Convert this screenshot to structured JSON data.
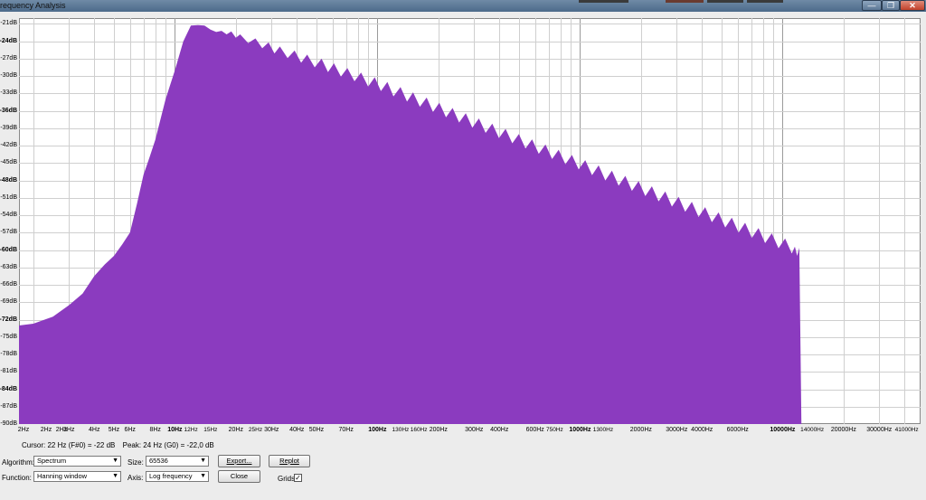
{
  "window": {
    "title": "requency Analysis",
    "controls": {
      "minimize_icon": "—",
      "maximize_icon": "❐",
      "close_icon": "✕"
    }
  },
  "colors": {
    "spectrum_fill": "#8b3bbf",
    "grid": "#cfcfcf",
    "plot_bg": "#ffffff",
    "close_red": "#c1412a"
  },
  "status": {
    "cursor": "Cursor: 22 Hz (F#0) = -22 dB",
    "peak": "Peak: 24 Hz (G0) = -22,0 dB"
  },
  "controls": {
    "algorithm_label": "Algorithm:",
    "algorithm_value": "Spectrum",
    "size_label": "Size:",
    "size_value": "65536",
    "export_label": "Export...",
    "replot_label": "Replot",
    "function_label": "Function:",
    "function_value": "Hanning window",
    "axis_label": "Axis:",
    "axis_value": "Log frequency",
    "close_label": "Close",
    "grids_label": "Grids",
    "grids_checked": true,
    "grids_check": "✓"
  },
  "chart_data": {
    "type": "area",
    "x_scale": "log",
    "xlim": [
      1.7,
      48000
    ],
    "ylim": [
      -90,
      -20
    ],
    "grid": true,
    "y_ticks": [
      {
        "v": -21,
        "label": "-21dB",
        "bold": false
      },
      {
        "v": -24,
        "label": "-24dB",
        "bold": true
      },
      {
        "v": -27,
        "label": "-27dB",
        "bold": false
      },
      {
        "v": -30,
        "label": "-30dB",
        "bold": false
      },
      {
        "v": -33,
        "label": "-33dB",
        "bold": false
      },
      {
        "v": -36,
        "label": "-36dB",
        "bold": true
      },
      {
        "v": -39,
        "label": "-39dB",
        "bold": false
      },
      {
        "v": -42,
        "label": "-42dB",
        "bold": false
      },
      {
        "v": -45,
        "label": "-45dB",
        "bold": false
      },
      {
        "v": -48,
        "label": "-48dB",
        "bold": true
      },
      {
        "v": -51,
        "label": "-51dB",
        "bold": false
      },
      {
        "v": -54,
        "label": "-54dB",
        "bold": false
      },
      {
        "v": -57,
        "label": "-57dB",
        "bold": false
      },
      {
        "v": -60,
        "label": "-60dB",
        "bold": true
      },
      {
        "v": -63,
        "label": "-63dB",
        "bold": false
      },
      {
        "v": -66,
        "label": "-66dB",
        "bold": false
      },
      {
        "v": -69,
        "label": "-69dB",
        "bold": false
      },
      {
        "v": -72,
        "label": "-72dB",
        "bold": true
      },
      {
        "v": -75,
        "label": "-75dB",
        "bold": false
      },
      {
        "v": -78,
        "label": "-78dB",
        "bold": false
      },
      {
        "v": -81,
        "label": "-81dB",
        "bold": false
      },
      {
        "v": -84,
        "label": "-84dB",
        "bold": true
      },
      {
        "v": -87,
        "label": "-87dB",
        "bold": false
      },
      {
        "v": -90,
        "label": "-90dB",
        "bold": false
      }
    ],
    "x_ticks": [
      {
        "v": 2,
        "label": "2Hz"
      },
      {
        "v": 2,
        "label": "2Hz"
      },
      {
        "v": 2,
        "label": "2Hz"
      },
      {
        "v": 3,
        "label": "3Hz"
      },
      {
        "v": 4,
        "label": "4Hz"
      },
      {
        "v": 5,
        "label": "5Hz"
      },
      {
        "v": 6,
        "label": "6Hz"
      },
      {
        "v": 8,
        "label": "8Hz"
      },
      {
        "v": 10,
        "label": "10Hz",
        "bold": true
      },
      {
        "v": 12,
        "label": "12Hz",
        "small": true
      },
      {
        "v": 15,
        "label": "15Hz",
        "small": true
      },
      {
        "v": 20,
        "label": "20Hz"
      },
      {
        "v": 25,
        "label": "25Hz",
        "small": true
      },
      {
        "v": 30,
        "label": "30Hz"
      },
      {
        "v": 40,
        "label": "40Hz"
      },
      {
        "v": 50,
        "label": "50Hz"
      },
      {
        "v": 70,
        "label": "70Hz"
      },
      {
        "v": 100,
        "label": "100Hz",
        "bold": true
      },
      {
        "v": 130,
        "label": "130Hz",
        "small": true
      },
      {
        "v": 160,
        "label": "160Hz",
        "small": true
      },
      {
        "v": 200,
        "label": "200Hz"
      },
      {
        "v": 300,
        "label": "300Hz"
      },
      {
        "v": 400,
        "label": "400Hz"
      },
      {
        "v": 600,
        "label": "600Hz"
      },
      {
        "v": 750,
        "label": "750Hz",
        "small": true
      },
      {
        "v": 1000,
        "label": "1000Hz",
        "bold": true
      },
      {
        "v": 1300,
        "label": "1300Hz",
        "small": true
      },
      {
        "v": 2000,
        "label": "2000Hz"
      },
      {
        "v": 3000,
        "label": "3000Hz"
      },
      {
        "v": 4000,
        "label": "4000Hz"
      },
      {
        "v": 6000,
        "label": "6000Hz"
      },
      {
        "v": 10000,
        "label": "10000Hz",
        "bold": true
      },
      {
        "v": 14000,
        "label": "14000Hz",
        "small": true
      },
      {
        "v": 20000,
        "label": "20000Hz"
      },
      {
        "v": 30000,
        "label": "30000Hz"
      },
      {
        "v": 41000,
        "label": "41000Hz",
        "small": true
      }
    ],
    "series": [
      {
        "points": [
          [
            1.7,
            -73
          ],
          [
            2,
            -72.7
          ],
          [
            2.5,
            -71.5
          ],
          [
            3,
            -69.5
          ],
          [
            3.5,
            -67.5
          ],
          [
            4,
            -64.5
          ],
          [
            4.5,
            -62.5
          ],
          [
            5,
            -61
          ],
          [
            5.5,
            -59
          ],
          [
            6,
            -57
          ],
          [
            6.5,
            -52
          ],
          [
            7,
            -47
          ],
          [
            7.5,
            -44
          ],
          [
            8,
            -41
          ],
          [
            9,
            -34
          ],
          [
            10,
            -29
          ],
          [
            11,
            -24
          ],
          [
            12,
            -21.3
          ],
          [
            13,
            -21.2
          ],
          [
            14,
            -21.3
          ],
          [
            15,
            -22
          ],
          [
            16,
            -22.4
          ],
          [
            17,
            -22.2
          ],
          [
            18,
            -22.8
          ],
          [
            19,
            -22.3
          ],
          [
            20,
            -23.4
          ],
          [
            21,
            -22.8
          ],
          [
            23,
            -24.3
          ],
          [
            25,
            -23.5
          ],
          [
            27,
            -25.2
          ],
          [
            29,
            -24.2
          ],
          [
            31,
            -26.1
          ],
          [
            33,
            -24.9
          ],
          [
            36,
            -26.9
          ],
          [
            39,
            -25.6
          ],
          [
            42,
            -27.7
          ],
          [
            45,
            -26.3
          ],
          [
            49,
            -28.5
          ],
          [
            53,
            -27
          ],
          [
            57,
            -29.3
          ],
          [
            61,
            -27.8
          ],
          [
            66,
            -30.1
          ],
          [
            71,
            -28.6
          ],
          [
            77,
            -30.9
          ],
          [
            83,
            -29.4
          ],
          [
            90,
            -31.8
          ],
          [
            97,
            -30.2
          ],
          [
            104,
            -32.6
          ],
          [
            112,
            -31
          ],
          [
            120,
            -33.5
          ],
          [
            130,
            -31.9
          ],
          [
            140,
            -34.4
          ],
          [
            150,
            -32.8
          ],
          [
            162,
            -35.3
          ],
          [
            175,
            -33.7
          ],
          [
            188,
            -36.2
          ],
          [
            202,
            -34.6
          ],
          [
            218,
            -37.1
          ],
          [
            235,
            -35.5
          ],
          [
            253,
            -38
          ],
          [
            273,
            -36.4
          ],
          [
            294,
            -38.9
          ],
          [
            317,
            -37.3
          ],
          [
            342,
            -39.8
          ],
          [
            369,
            -38.2
          ],
          [
            398,
            -40.7
          ],
          [
            429,
            -39.1
          ],
          [
            463,
            -41.6
          ],
          [
            499,
            -40
          ],
          [
            538,
            -42.5
          ],
          [
            580,
            -40.9
          ],
          [
            626,
            -43.4
          ],
          [
            675,
            -41.8
          ],
          [
            728,
            -44.3
          ],
          [
            785,
            -42.7
          ],
          [
            847,
            -45.2
          ],
          [
            913,
            -43.6
          ],
          [
            985,
            -46.1
          ],
          [
            1062,
            -44.5
          ],
          [
            1146,
            -47.1
          ],
          [
            1236,
            -45.4
          ],
          [
            1333,
            -48
          ],
          [
            1438,
            -46.3
          ],
          [
            1551,
            -48.9
          ],
          [
            1673,
            -47.2
          ],
          [
            1805,
            -49.8
          ],
          [
            1947,
            -48.1
          ],
          [
            2100,
            -50.7
          ],
          [
            2265,
            -49
          ],
          [
            2443,
            -51.6
          ],
          [
            2635,
            -49.9
          ],
          [
            2842,
            -52.5
          ],
          [
            3066,
            -50.8
          ],
          [
            3307,
            -53.4
          ],
          [
            3567,
            -51.7
          ],
          [
            3848,
            -54.3
          ],
          [
            4150,
            -52.6
          ],
          [
            4477,
            -55.2
          ],
          [
            4829,
            -53.5
          ],
          [
            5209,
            -56.1
          ],
          [
            5618,
            -54.4
          ],
          [
            6060,
            -57
          ],
          [
            6537,
            -55.3
          ],
          [
            7051,
            -57.9
          ],
          [
            7606,
            -56.2
          ],
          [
            8204,
            -58.8
          ],
          [
            8850,
            -57.1
          ],
          [
            9546,
            -59.7
          ],
          [
            10296,
            -58
          ],
          [
            11106,
            -60.6
          ],
          [
            11500,
            -59.4
          ],
          [
            11800,
            -61
          ],
          [
            12100,
            -59.6
          ],
          [
            12400,
            -91
          ]
        ]
      }
    ]
  }
}
